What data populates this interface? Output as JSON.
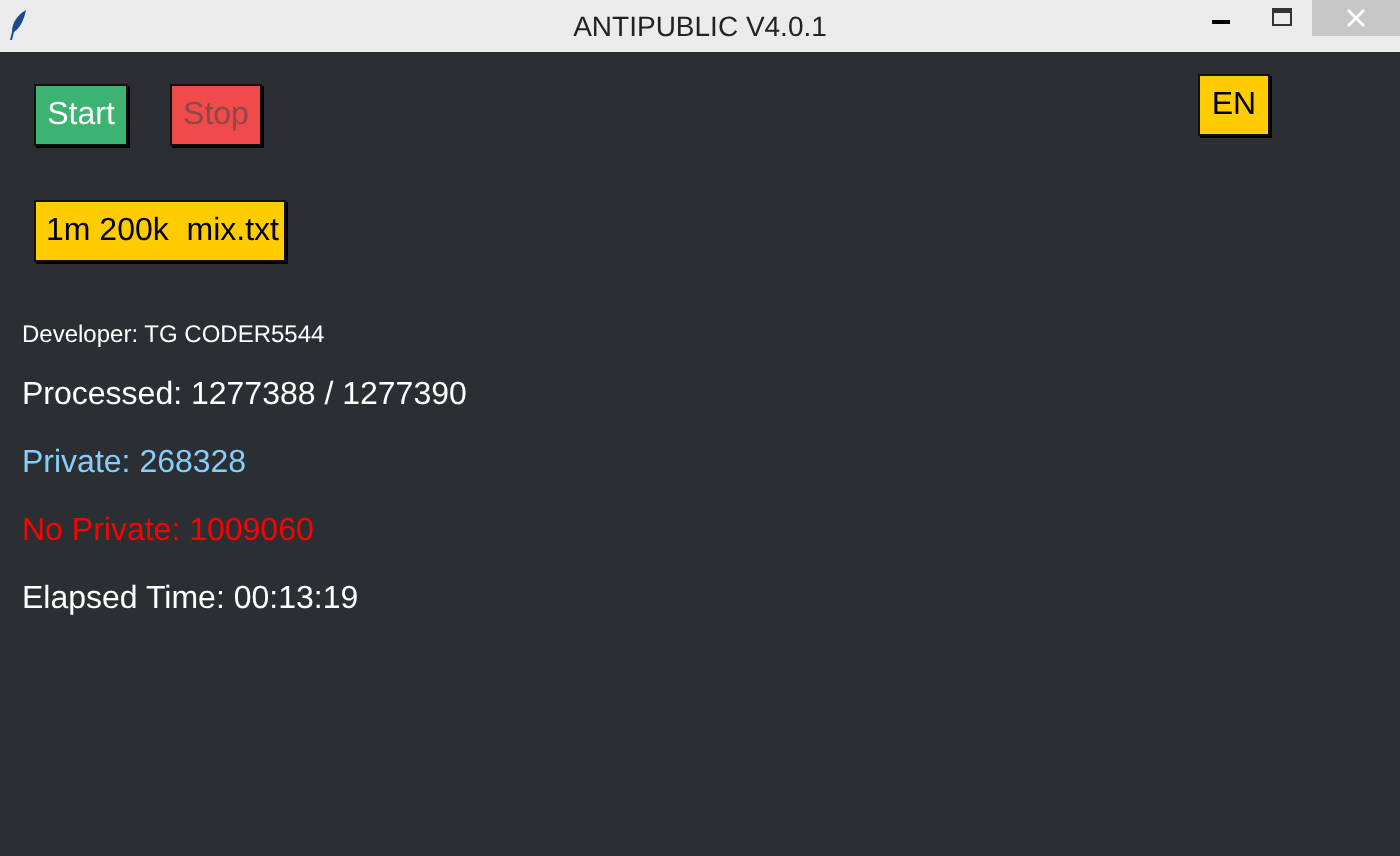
{
  "window": {
    "title": "ANTIPUBLIC V4.0.1"
  },
  "buttons": [
    {
      "label": "Start",
      "kind": "start",
      "disabled": false
    },
    {
      "label": "Stop",
      "kind": "stop",
      "disabled": true
    }
  ],
  "language_button": {
    "label": "EN"
  },
  "file_button": {
    "label": "1m 200k  mix.txt"
  },
  "developer": "Developer: TG CODER5544",
  "stats": [
    {
      "text": "Processed: 1277388 / 1277390",
      "color": "#ffffff"
    },
    {
      "text": "Private: 268328",
      "color": "#87cefa"
    },
    {
      "text": "No Private: 1009060",
      "color": "#ff0000"
    },
    {
      "text": "Elapsed Time: 00:13:19",
      "color": "#ffffff"
    }
  ]
}
